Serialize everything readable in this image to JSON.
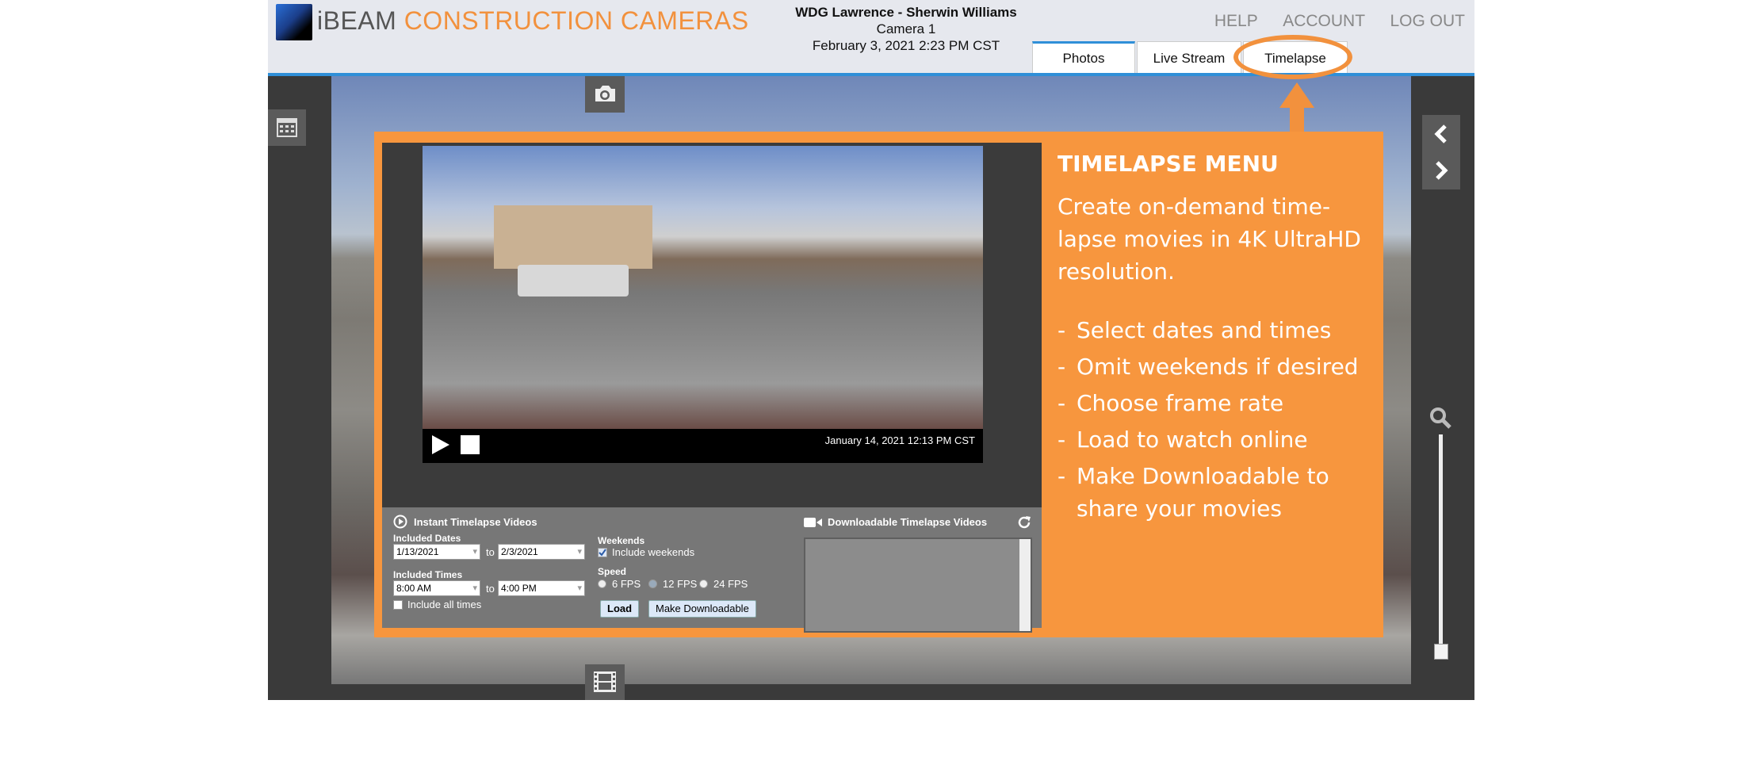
{
  "header": {
    "brand_prefix": "iBEAM",
    "brand_suffix": "CONSTRUCTION CAMERAS",
    "project_name": "WDG Lawrence - Sherwin Williams",
    "camera_name": "Camera 1",
    "datetime": "February 3, 2021 2:23 PM CST",
    "links": {
      "help": "HELP",
      "account": "ACCOUNT",
      "logout": "LOG OUT"
    },
    "tabs": [
      {
        "label": "Photos",
        "active": true
      },
      {
        "label": "Live Stream",
        "active": false
      },
      {
        "label": "Timelapse",
        "active": false
      }
    ]
  },
  "video": {
    "timestamp": "January 14, 2021 12:13 PM CST"
  },
  "instant": {
    "title": "Instant Timelapse Videos",
    "dates_label": "Included Dates",
    "date_from": "1/13/2021",
    "date_to": "2/3/2021",
    "to_label": "to",
    "times_label": "Included Times",
    "time_from": "8:00 AM",
    "time_to": "4:00 PM",
    "include_all_times": "Include all times",
    "weekends_label": "Weekends",
    "include_weekends": "Include weekends",
    "speed_label": "Speed",
    "speeds": [
      "6 FPS",
      "12 FPS",
      "24 FPS"
    ],
    "load_button": "Load",
    "download_button": "Make Downloadable"
  },
  "downloadable": {
    "title": "Downloadable Timelapse Videos"
  },
  "callout": {
    "title": "TIMELAPSE MENU",
    "intro": "Create on-demand time-lapse movies in 4K UltraHD resolution.",
    "bullets": [
      "Select dates and times",
      "Omit weekends if desired",
      "Choose frame rate",
      "Load to watch online",
      "Make Downloadable to share your movies"
    ]
  },
  "colors": {
    "accent": "#f7963e",
    "tab_border": "#2f8fd8"
  }
}
